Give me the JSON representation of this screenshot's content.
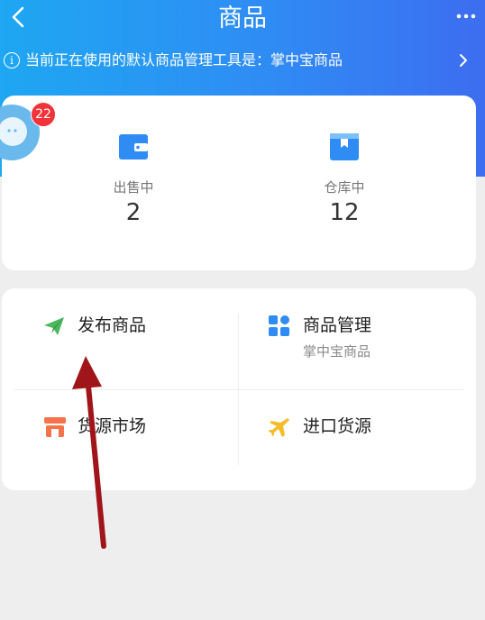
{
  "header": {
    "title": "商品",
    "back_icon": "chevron-left-icon",
    "more_icon": "more-horizontal-icon",
    "gradient": [
      "#1ea7f2",
      "#3d6df0"
    ]
  },
  "notice": {
    "text": "当前正在使用的默认商品管理工具是：掌中宝商品",
    "info_icon": "info-circle-icon",
    "arrow_icon": "chevron-right-icon"
  },
  "badge": {
    "count": "22",
    "color": "#f2333a"
  },
  "stats": [
    {
      "label": "出售中",
      "value": "2",
      "icon": "wallet-icon",
      "color": "#2f8cf4"
    },
    {
      "label": "仓库中",
      "value": "12",
      "icon": "warehouse-box-icon",
      "color": "#2f8cf4"
    }
  ],
  "actions": {
    "publish": {
      "label": "发布商品",
      "icon": "paper-plane-icon",
      "color": "#4cb85c"
    },
    "manage": {
      "label": "商品管理",
      "sub": "掌中宝商品",
      "icon": "grid-icon",
      "color": "#2f8cf4"
    },
    "market": {
      "label": "货源市场",
      "icon": "store-icon",
      "color": "#f5734a"
    },
    "import": {
      "label": "进口货源",
      "icon": "airplane-icon",
      "color": "#f6bd2b"
    }
  },
  "annotation": {
    "arrow_color": "#a0151a"
  }
}
